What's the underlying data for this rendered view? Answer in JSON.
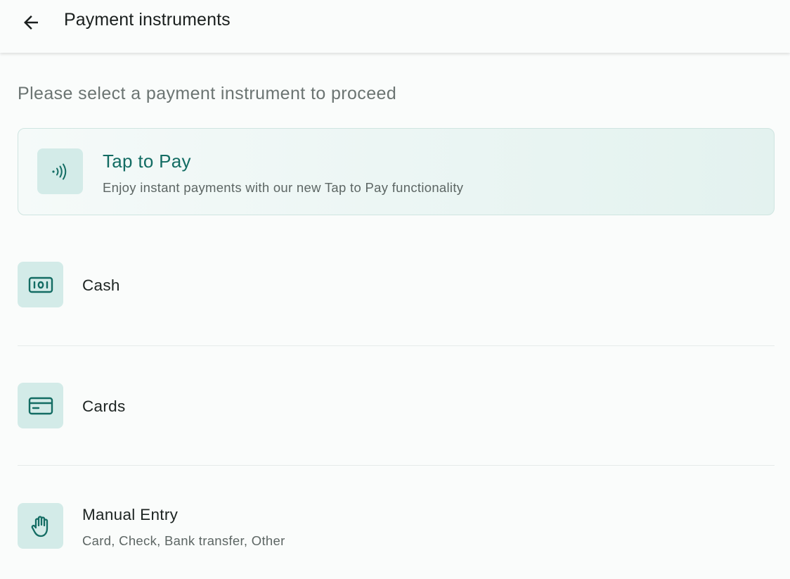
{
  "header": {
    "title": "Payment instruments",
    "back_icon": "arrow-left-icon"
  },
  "subtitle": "Please select a payment instrument to proceed",
  "tap_to_pay": {
    "title": "Tap to Pay",
    "description": "Enjoy instant payments with our new Tap to Pay functionality",
    "icon": "contactless-icon"
  },
  "instruments": [
    {
      "label": "Cash",
      "icon": "cash-icon"
    },
    {
      "label": "Cards",
      "icon": "card-icon"
    },
    {
      "label": "Manual Entry",
      "sublabel": "Card, Check, Bank transfer, Other",
      "icon": "hand-icon"
    }
  ],
  "colors": {
    "accent": "#136c63",
    "icon_tile": "#d3ebe8",
    "background": "#fafcfb"
  }
}
